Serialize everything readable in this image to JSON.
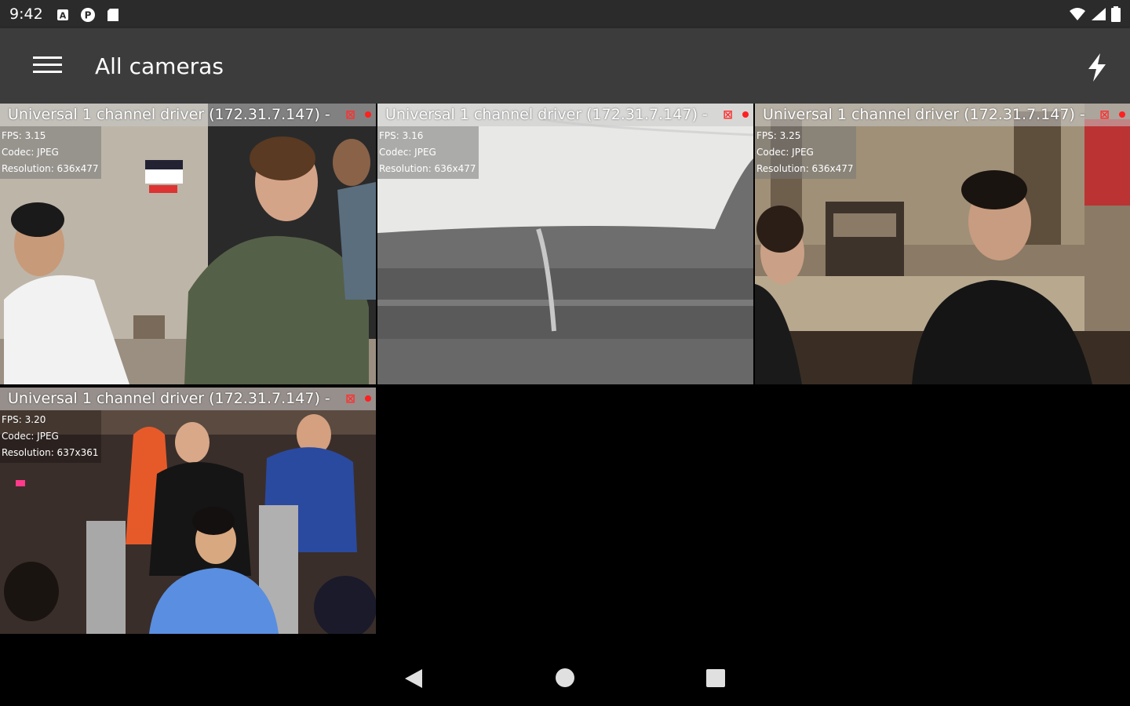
{
  "status": {
    "time": "9:42",
    "left_icons": [
      "a-badge-icon",
      "p-circle-icon",
      "sd-card-icon"
    ],
    "right_icons": [
      "wifi-icon",
      "cell-signal-icon",
      "battery-icon"
    ]
  },
  "appbar": {
    "title": "All cameras",
    "menu_icon": "hamburger-menu-icon",
    "action_icon": "flash-icon"
  },
  "tiles": [
    {
      "title": "Universal 1 channel driver (172.31.7.147) -",
      "fps": "FPS: 3.15",
      "codec": "Codec: JPEG",
      "resolution": "Resolution: 636x477"
    },
    {
      "title": "Universal 1 channel driver (172.31.7.147) -",
      "fps": "FPS: 3.16",
      "codec": "Codec: JPEG",
      "resolution": "Resolution: 636x477"
    },
    {
      "title": "Universal 1 channel driver (172.31.7.147) -",
      "fps": "FPS: 3.25",
      "codec": "Codec: JPEG",
      "resolution": "Resolution: 636x477"
    },
    {
      "title": "Universal 1 channel driver (172.31.7.147) -",
      "fps": "FPS: 3.20",
      "codec": "Codec: JPEG",
      "resolution": "Resolution: 637x361"
    }
  ],
  "navbar": {
    "back": "back-icon",
    "home": "home-icon",
    "recents": "recents-icon"
  },
  "colors": {
    "statusbar": "#2b2b2b",
    "appbar": "#3c3c3c",
    "record": "#ff2020",
    "background": "#000000"
  }
}
